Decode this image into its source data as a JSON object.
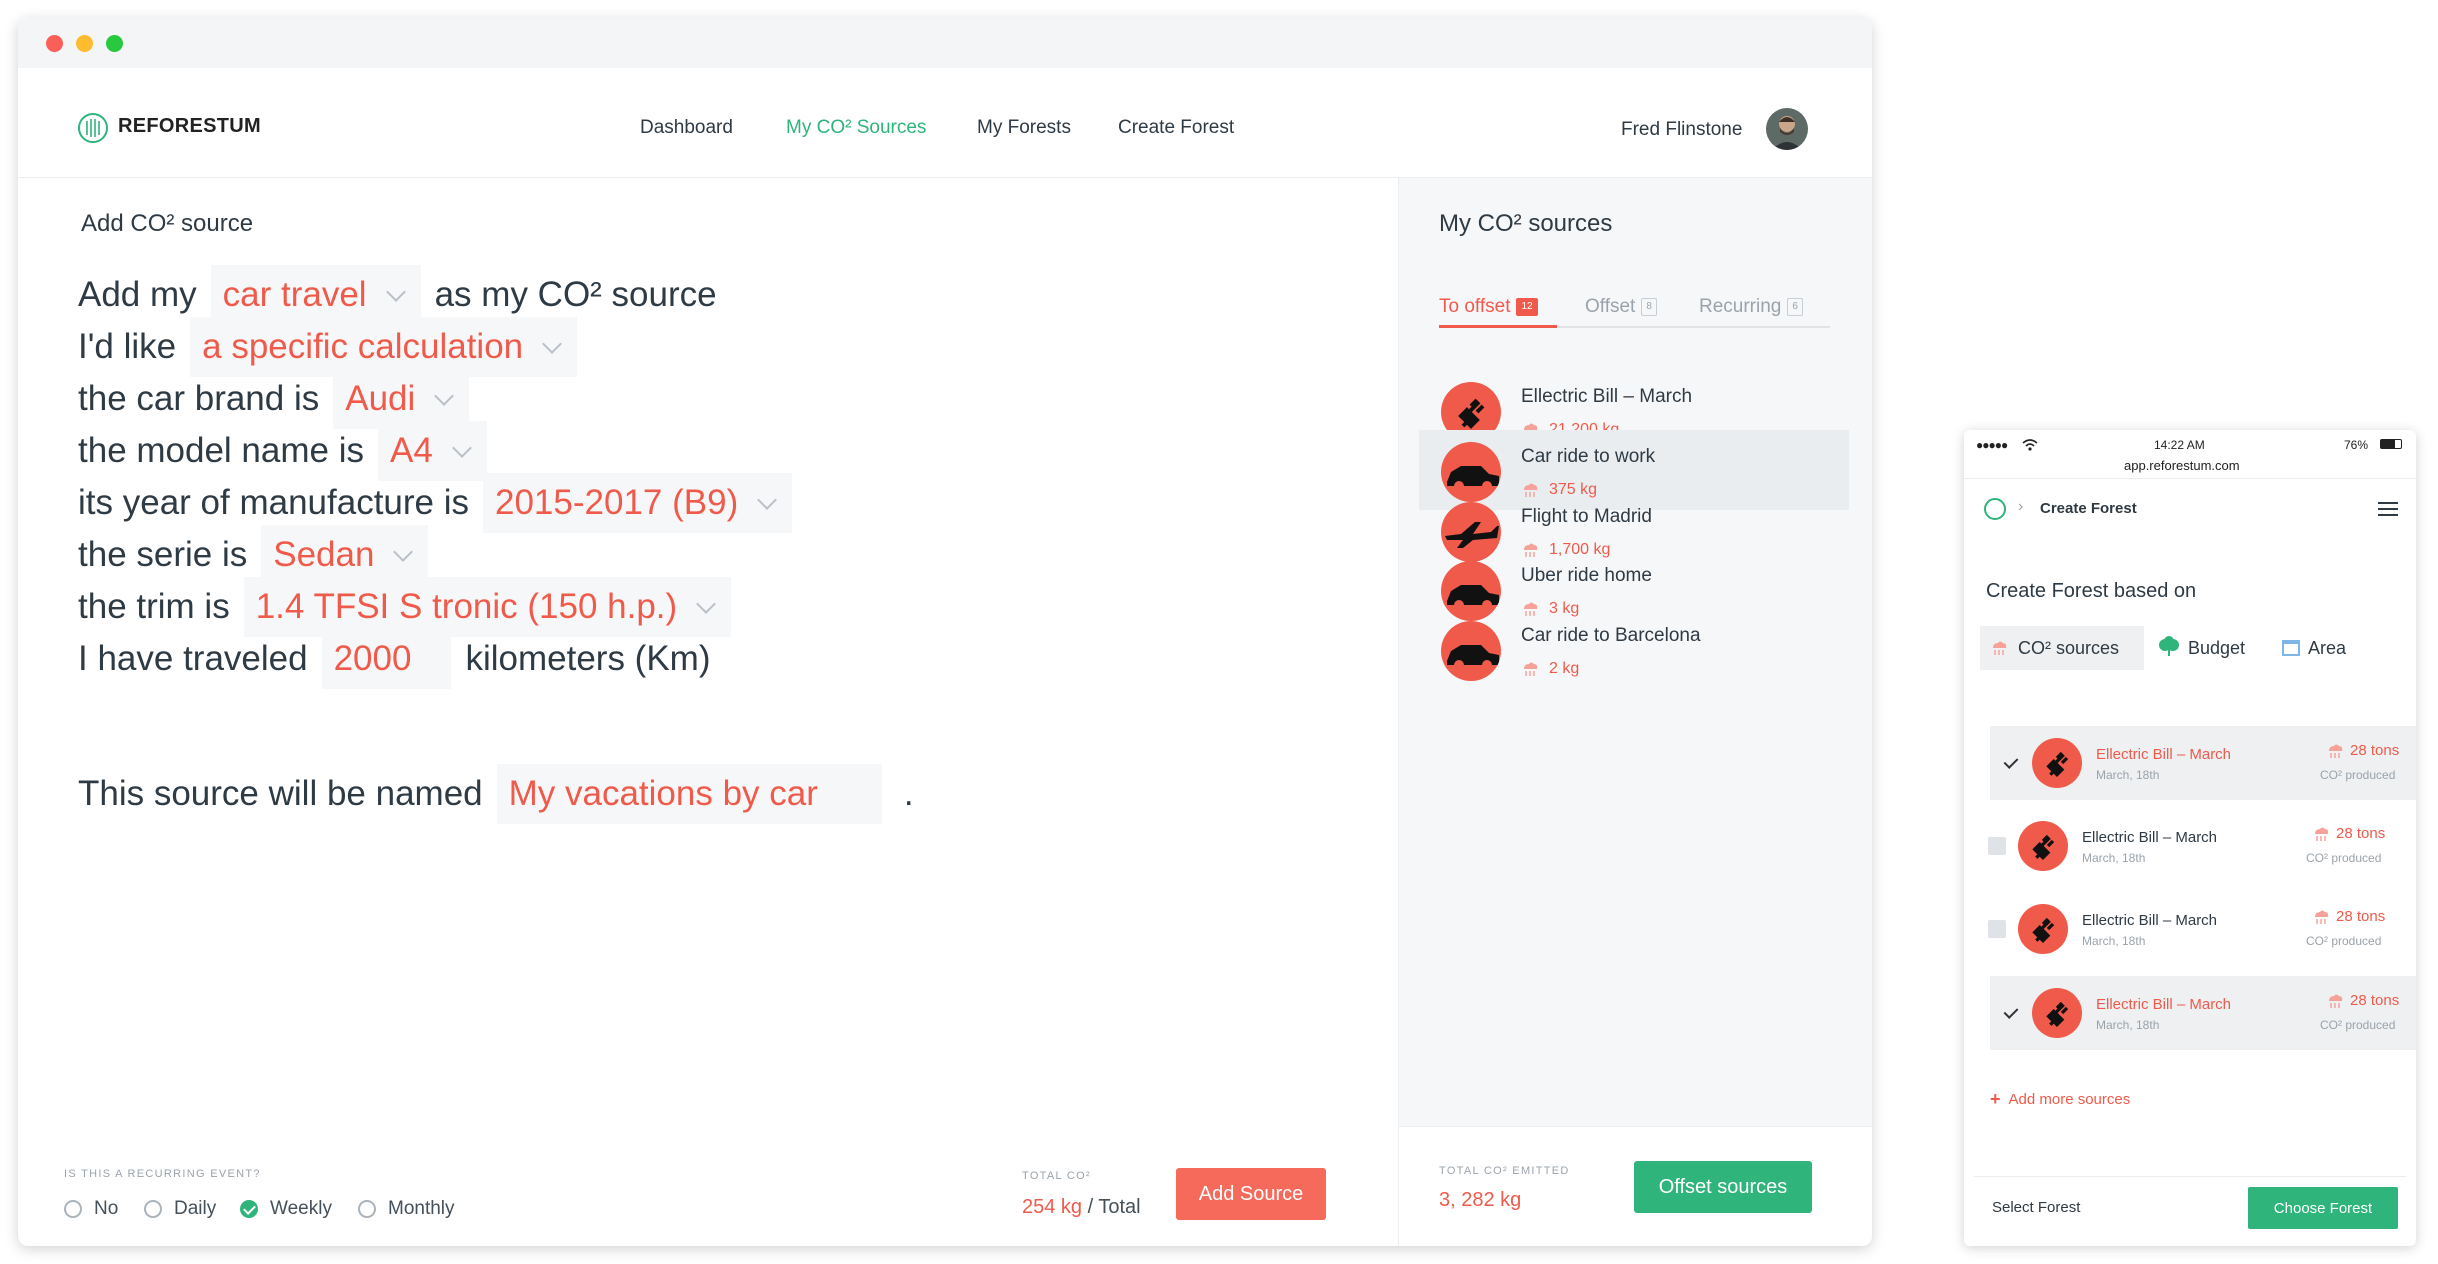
{
  "nav": {
    "brand": "REFORESTUM",
    "links": [
      "Dashboard",
      "My CO² Sources",
      "My Forests",
      "Create Forest"
    ],
    "active_link": "My CO² Sources",
    "user_name": "Fred Flinstone"
  },
  "form": {
    "heading": "Add CO² source",
    "rows": [
      {
        "prefix": "Add my",
        "value": "car travel",
        "suffix": "as my CO² source",
        "has_dropdown": true
      },
      {
        "prefix": "I'd like",
        "value": "a specific calculation",
        "suffix": "",
        "has_dropdown": true
      },
      {
        "prefix": "the car brand is",
        "value": "Audi",
        "suffix": "",
        "has_dropdown": true
      },
      {
        "prefix": "the model name is",
        "value": "A4",
        "suffix": "",
        "has_dropdown": true
      },
      {
        "prefix": "its year of manufacture is",
        "value": "2015-2017 (B9)",
        "suffix": "",
        "has_dropdown": true
      },
      {
        "prefix": "the serie is",
        "value": "Sedan",
        "suffix": "",
        "has_dropdown": true
      },
      {
        "prefix": "the trim is",
        "value": "1.4 TFSI S tronic (150 h.p.)",
        "suffix": "",
        "has_dropdown": true
      },
      {
        "prefix": "I have traveled",
        "value": "2000",
        "suffix": "kilometers (Km)",
        "has_dropdown": false
      }
    ],
    "name_row": {
      "prefix": "This source will be named",
      "value": "My vacations by car",
      "suffix": "."
    }
  },
  "recurring": {
    "label": "IS THIS A RECURRING EVENT?",
    "options": [
      "No",
      "Daily",
      "Weekly",
      "Monthly"
    ],
    "selected": "Weekly"
  },
  "total": {
    "label": "TOTAL CO²",
    "value": "254 kg",
    "suffix": "/ Total",
    "button": "Add Source"
  },
  "sidebar": {
    "title": "My CO² sources",
    "tabs": [
      {
        "label": "To offset",
        "count": "12"
      },
      {
        "label": "Offset",
        "count": "8"
      },
      {
        "label": "Recurring",
        "count": "6"
      }
    ],
    "active_tab": "To offset",
    "sources": [
      {
        "name": "Ellectric Bill – March",
        "amount": "21,200 kg",
        "icon": "plug-icon"
      },
      {
        "name": "Car ride to work",
        "amount": "375 kg",
        "icon": "car-icon"
      },
      {
        "name": "Flight to Madrid",
        "amount": "1,700 kg",
        "icon": "plane-icon"
      },
      {
        "name": "Uber ride home",
        "amount": "3 kg",
        "icon": "car-icon"
      },
      {
        "name": "Car ride to Barcelona",
        "amount": "2 kg",
        "icon": "car-icon"
      }
    ],
    "highlighted_index": 1,
    "footer_label": "TOTAL CO² EMITTED",
    "footer_value": "3, 282 kg",
    "footer_button": "Offset sources"
  },
  "phone": {
    "carrier": "●●●●●",
    "time": "14:22 AM",
    "battery": "76%",
    "url": "app.reforestum.com",
    "breadcrumb": "Create Forest",
    "heading": "Create Forest based on",
    "options": [
      {
        "label": "CO² sources",
        "icon": "cloud-icon"
      },
      {
        "label": "Budget",
        "icon": "tree-icon"
      },
      {
        "label": "Area",
        "icon": "area-icon"
      }
    ],
    "selected_option": "CO² sources",
    "rows": [
      {
        "name": "Ellectric Bill – March",
        "date": "March, 18th",
        "tons": "28 tons",
        "produced": "CO² produced",
        "checked": true
      },
      {
        "name": "Ellectric Bill – March",
        "date": "March, 18th",
        "tons": "28 tons",
        "produced": "CO² produced",
        "checked": false
      },
      {
        "name": "Ellectric Bill – March",
        "date": "March, 18th",
        "tons": "28 tons",
        "produced": "CO² produced",
        "checked": false
      },
      {
        "name": "Ellectric Bill – March",
        "date": "March, 18th",
        "tons": "28 tons",
        "produced": "CO² produced",
        "checked": true
      }
    ],
    "add_more": "Add more sources",
    "footer_label": "Select Forest",
    "footer_button": "Choose Forest"
  },
  "colors": {
    "accent_red": "#f05a4b",
    "accent_green": "#2fb47c",
    "text": "#2e3a44"
  }
}
